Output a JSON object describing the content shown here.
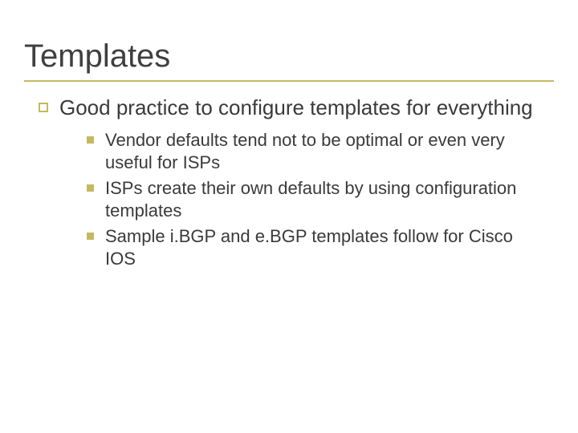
{
  "title": "Templates",
  "lvl1": "Good practice to configure templates for everything",
  "lvl2": [
    "Vendor defaults tend not to be optimal or even very useful for ISPs",
    "ISPs create their own defaults by using configuration templates",
    "Sample i.BGP and e.BGP templates follow for Cisco IOS"
  ]
}
